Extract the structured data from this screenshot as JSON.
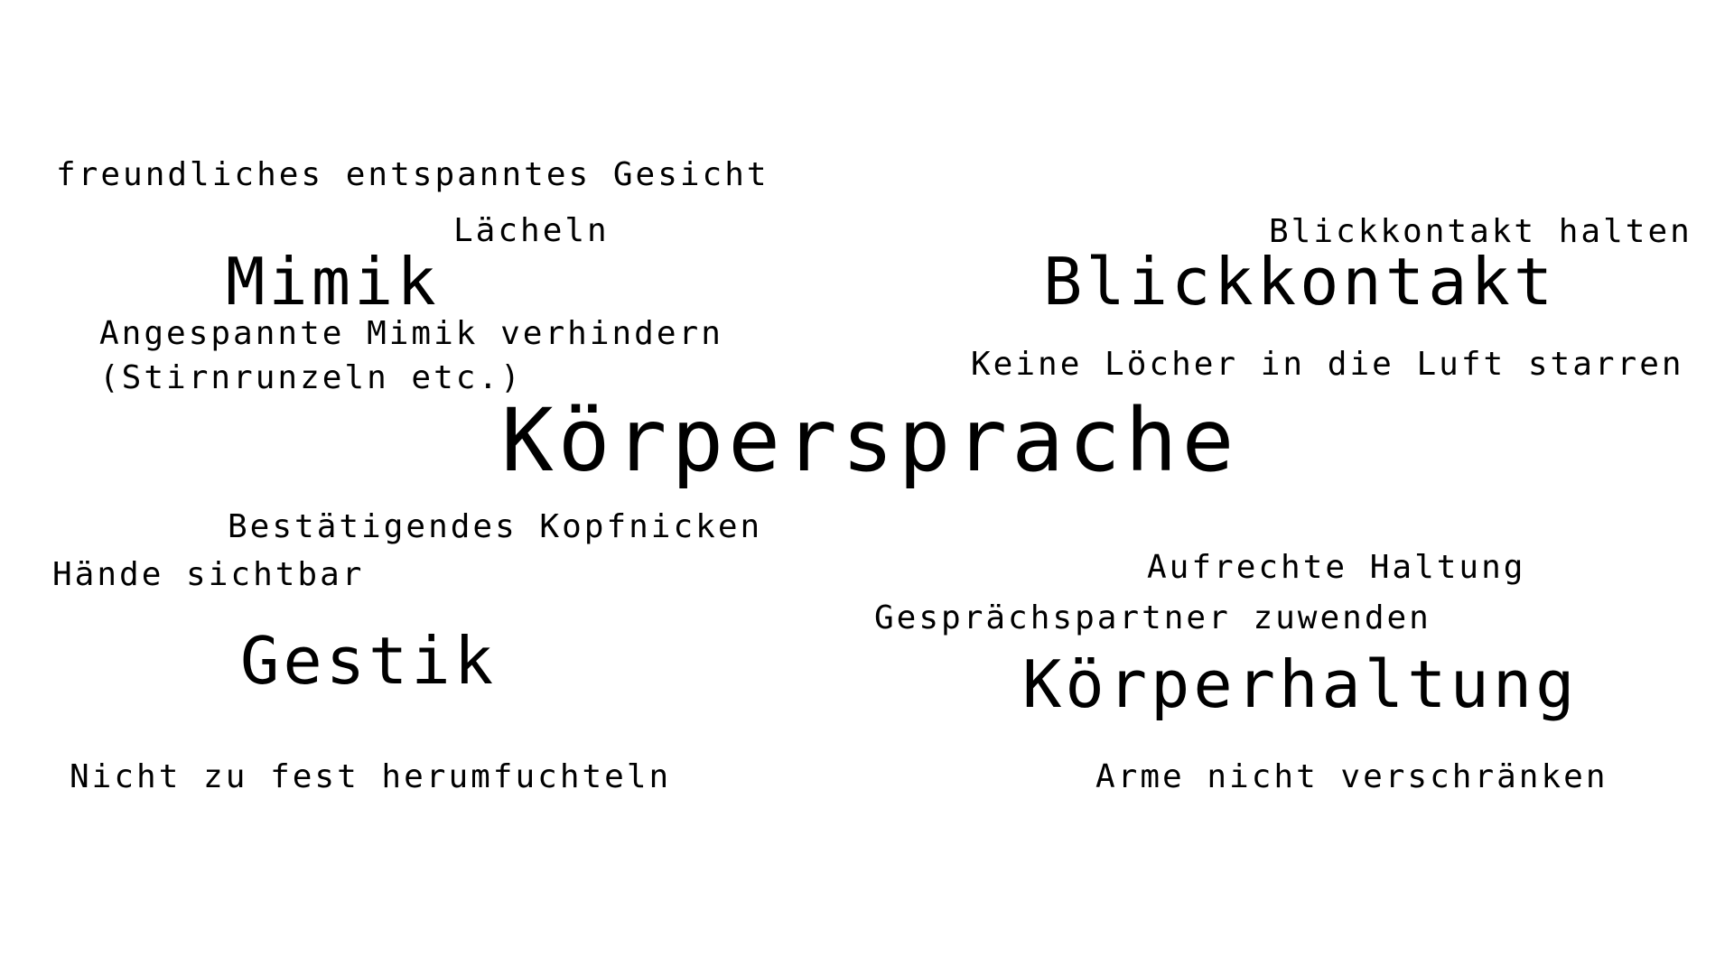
{
  "center": {
    "title": "Körpersprache"
  },
  "mimik": {
    "heading": "Mimik",
    "items": [
      "freundliches entspanntes Gesicht",
      "Lächeln",
      "Angespannte Mimik verhindern\n(Stirnrunzeln etc.)"
    ]
  },
  "blickkontakt": {
    "heading": "Blickkontakt",
    "items": [
      "Blickkontakt halten",
      "Keine Löcher in die Luft starren"
    ]
  },
  "gestik": {
    "heading": "Gestik",
    "items": [
      "Bestätigendes Kopfnicken",
      "Hände sichtbar",
      "Nicht zu fest herumfuchteln"
    ]
  },
  "koerperhaltung": {
    "heading": "Körperhaltung",
    "items": [
      "Aufrechte Haltung",
      "Gesprächspartner zuwenden",
      "Arme nicht verschränken"
    ]
  }
}
